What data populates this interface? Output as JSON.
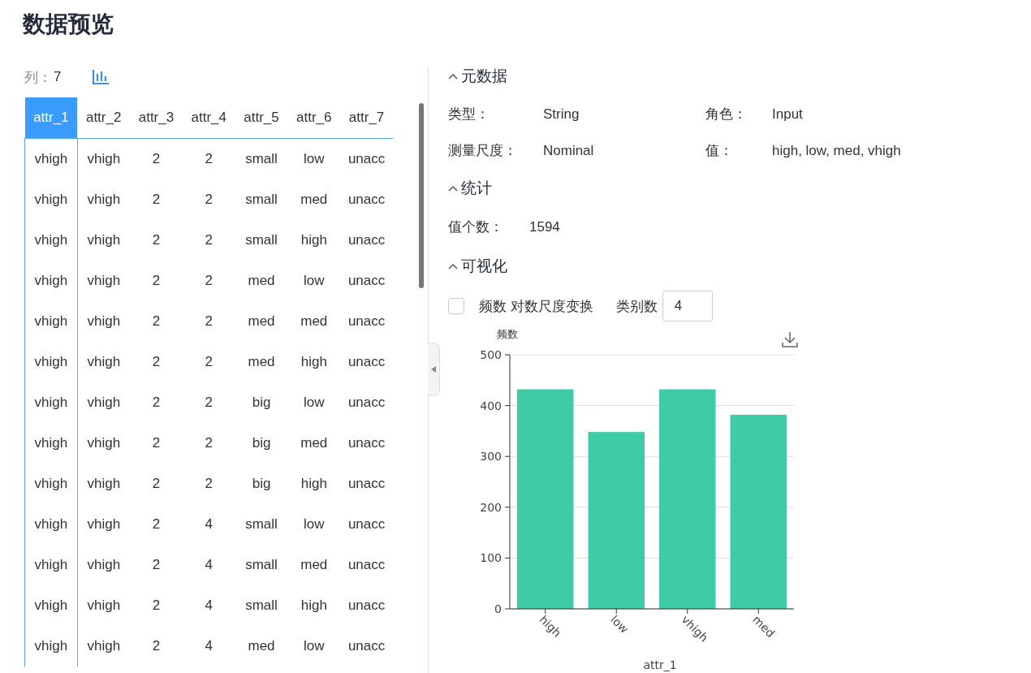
{
  "title": "数据预览",
  "columns_info": {
    "label": "列：",
    "count": "7"
  },
  "table": {
    "columns": [
      {
        "label": "attr_1",
        "selected": true
      },
      {
        "label": "attr_2",
        "selected": false
      },
      {
        "label": "attr_3",
        "selected": false
      },
      {
        "label": "attr_4",
        "selected": false
      },
      {
        "label": "attr_5",
        "selected": false
      },
      {
        "label": "attr_6",
        "selected": false
      },
      {
        "label": "attr_7",
        "selected": false
      }
    ],
    "rows": [
      [
        "vhigh",
        "vhigh",
        "2",
        "2",
        "small",
        "low",
        "unacc"
      ],
      [
        "vhigh",
        "vhigh",
        "2",
        "2",
        "small",
        "med",
        "unacc"
      ],
      [
        "vhigh",
        "vhigh",
        "2",
        "2",
        "small",
        "high",
        "unacc"
      ],
      [
        "vhigh",
        "vhigh",
        "2",
        "2",
        "med",
        "low",
        "unacc"
      ],
      [
        "vhigh",
        "vhigh",
        "2",
        "2",
        "med",
        "med",
        "unacc"
      ],
      [
        "vhigh",
        "vhigh",
        "2",
        "2",
        "med",
        "high",
        "unacc"
      ],
      [
        "vhigh",
        "vhigh",
        "2",
        "2",
        "big",
        "low",
        "unacc"
      ],
      [
        "vhigh",
        "vhigh",
        "2",
        "2",
        "big",
        "med",
        "unacc"
      ],
      [
        "vhigh",
        "vhigh",
        "2",
        "2",
        "big",
        "high",
        "unacc"
      ],
      [
        "vhigh",
        "vhigh",
        "2",
        "4",
        "small",
        "low",
        "unacc"
      ],
      [
        "vhigh",
        "vhigh",
        "2",
        "4",
        "small",
        "med",
        "unacc"
      ],
      [
        "vhigh",
        "vhigh",
        "2",
        "4",
        "small",
        "high",
        "unacc"
      ],
      [
        "vhigh",
        "vhigh",
        "2",
        "4",
        "med",
        "low",
        "unacc"
      ]
    ]
  },
  "metadata": {
    "title": "元数据",
    "expanded": true,
    "fields": [
      {
        "label": "类型：",
        "value": "String"
      },
      {
        "label": "角色：",
        "value": "Input"
      },
      {
        "label": "测量尺度：",
        "value": "Nominal"
      },
      {
        "label": "值：",
        "value": "high, low, med, vhigh"
      }
    ]
  },
  "statistics": {
    "title": "统计",
    "expanded": true,
    "fields": [
      {
        "label": "值个数：",
        "value": "1594"
      }
    ]
  },
  "visualization": {
    "title": "可视化",
    "expanded": true,
    "log_scale": {
      "label": "频数 对数尺度变换",
      "checked": false
    },
    "category_count": {
      "label": "类别数",
      "value": "4"
    },
    "chart_data": {
      "type": "bar",
      "xlabel": "attr_1",
      "ylabel": "频数",
      "categories": [
        "high",
        "low",
        "vhigh",
        "med"
      ],
      "series": [
        {
          "color": "#3ecba5",
          "values": [
            432,
            348,
            432,
            382
          ]
        }
      ],
      "ylim": [
        0,
        500
      ],
      "yticks": [
        0,
        100,
        200,
        300,
        400,
        500
      ],
      "grid": true
    }
  }
}
